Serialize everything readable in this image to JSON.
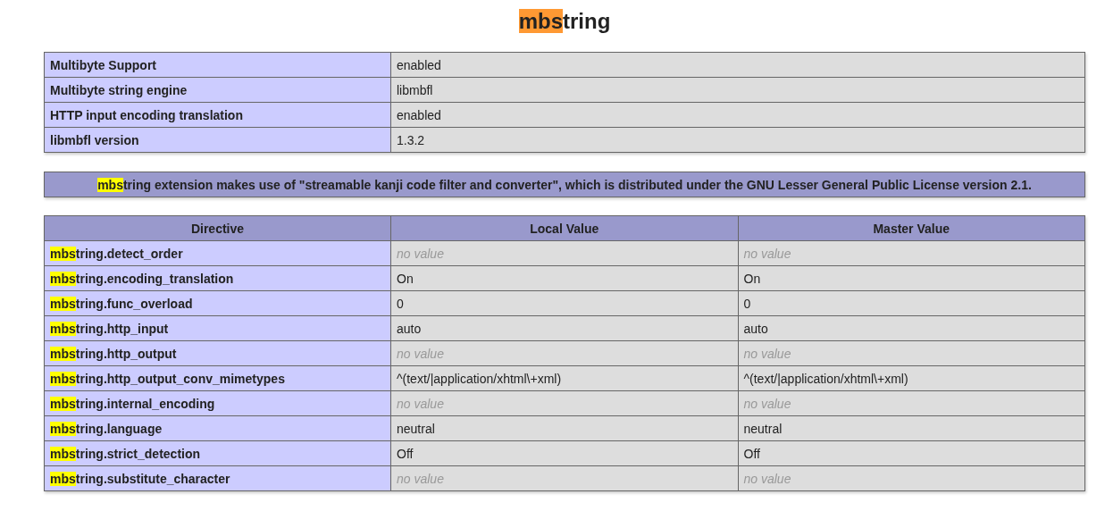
{
  "title": {
    "highlight": {
      "text": "mbs",
      "current": true
    },
    "text": "tring"
  },
  "info_table": {
    "rows": [
      {
        "label": {
          "text": "Multibyte Support"
        },
        "value": {
          "text": "enabled",
          "empty": false
        }
      },
      {
        "label": {
          "text": "Multibyte string engine"
        },
        "value": {
          "text": "libmbfl",
          "empty": false
        }
      },
      {
        "label": {
          "text": "HTTP input encoding translation"
        },
        "value": {
          "text": "enabled",
          "empty": false
        }
      },
      {
        "label": {
          "text": "libmbfl version"
        },
        "value": {
          "text": "1.3.2",
          "empty": false
        }
      }
    ]
  },
  "note": {
    "highlight": {
      "text": "mbs",
      "current": false
    },
    "text": "tring extension makes use of \"streamable kanji code filter and converter\", which is distributed under the GNU Lesser General Public License version 2.1."
  },
  "directives_table": {
    "columns": [
      "Directive",
      "Local Value",
      "Master Value"
    ],
    "rows": [
      {
        "directive": {
          "highlight": {
            "text": "mbs",
            "current": false
          },
          "text": "tring.detect_order"
        },
        "local": {
          "text": "no value",
          "empty": true
        },
        "master": {
          "text": "no value",
          "empty": true
        }
      },
      {
        "directive": {
          "highlight": {
            "text": "mbs",
            "current": false
          },
          "text": "tring.encoding_translation"
        },
        "local": {
          "text": "On",
          "empty": false
        },
        "master": {
          "text": "On",
          "empty": false
        }
      },
      {
        "directive": {
          "highlight": {
            "text": "mbs",
            "current": false
          },
          "text": "tring.func_overload"
        },
        "local": {
          "text": "0",
          "empty": false
        },
        "master": {
          "text": "0",
          "empty": false
        }
      },
      {
        "directive": {
          "highlight": {
            "text": "mbs",
            "current": false
          },
          "text": "tring.http_input"
        },
        "local": {
          "text": "auto",
          "empty": false
        },
        "master": {
          "text": "auto",
          "empty": false
        }
      },
      {
        "directive": {
          "highlight": {
            "text": "mbs",
            "current": false
          },
          "text": "tring.http_output"
        },
        "local": {
          "text": "no value",
          "empty": true
        },
        "master": {
          "text": "no value",
          "empty": true
        }
      },
      {
        "directive": {
          "highlight": {
            "text": "mbs",
            "current": false
          },
          "text": "tring.http_output_conv_mimetypes"
        },
        "local": {
          "text": "^(text/|application/xhtml\\+xml)",
          "empty": false
        },
        "master": {
          "text": "^(text/|application/xhtml\\+xml)",
          "empty": false
        }
      },
      {
        "directive": {
          "highlight": {
            "text": "mbs",
            "current": false
          },
          "text": "tring.internal_encoding"
        },
        "local": {
          "text": "no value",
          "empty": true
        },
        "master": {
          "text": "no value",
          "empty": true
        }
      },
      {
        "directive": {
          "highlight": {
            "text": "mbs",
            "current": false
          },
          "text": "tring.language"
        },
        "local": {
          "text": "neutral",
          "empty": false
        },
        "master": {
          "text": "neutral",
          "empty": false
        }
      },
      {
        "directive": {
          "highlight": {
            "text": "mbs",
            "current": false
          },
          "text": "tring.strict_detection"
        },
        "local": {
          "text": "Off",
          "empty": false
        },
        "master": {
          "text": "Off",
          "empty": false
        }
      },
      {
        "directive": {
          "highlight": {
            "text": "mbs",
            "current": false
          },
          "text": "tring.substitute_character"
        },
        "local": {
          "text": "no value",
          "empty": true
        },
        "master": {
          "text": "no value",
          "empty": true
        }
      }
    ]
  }
}
